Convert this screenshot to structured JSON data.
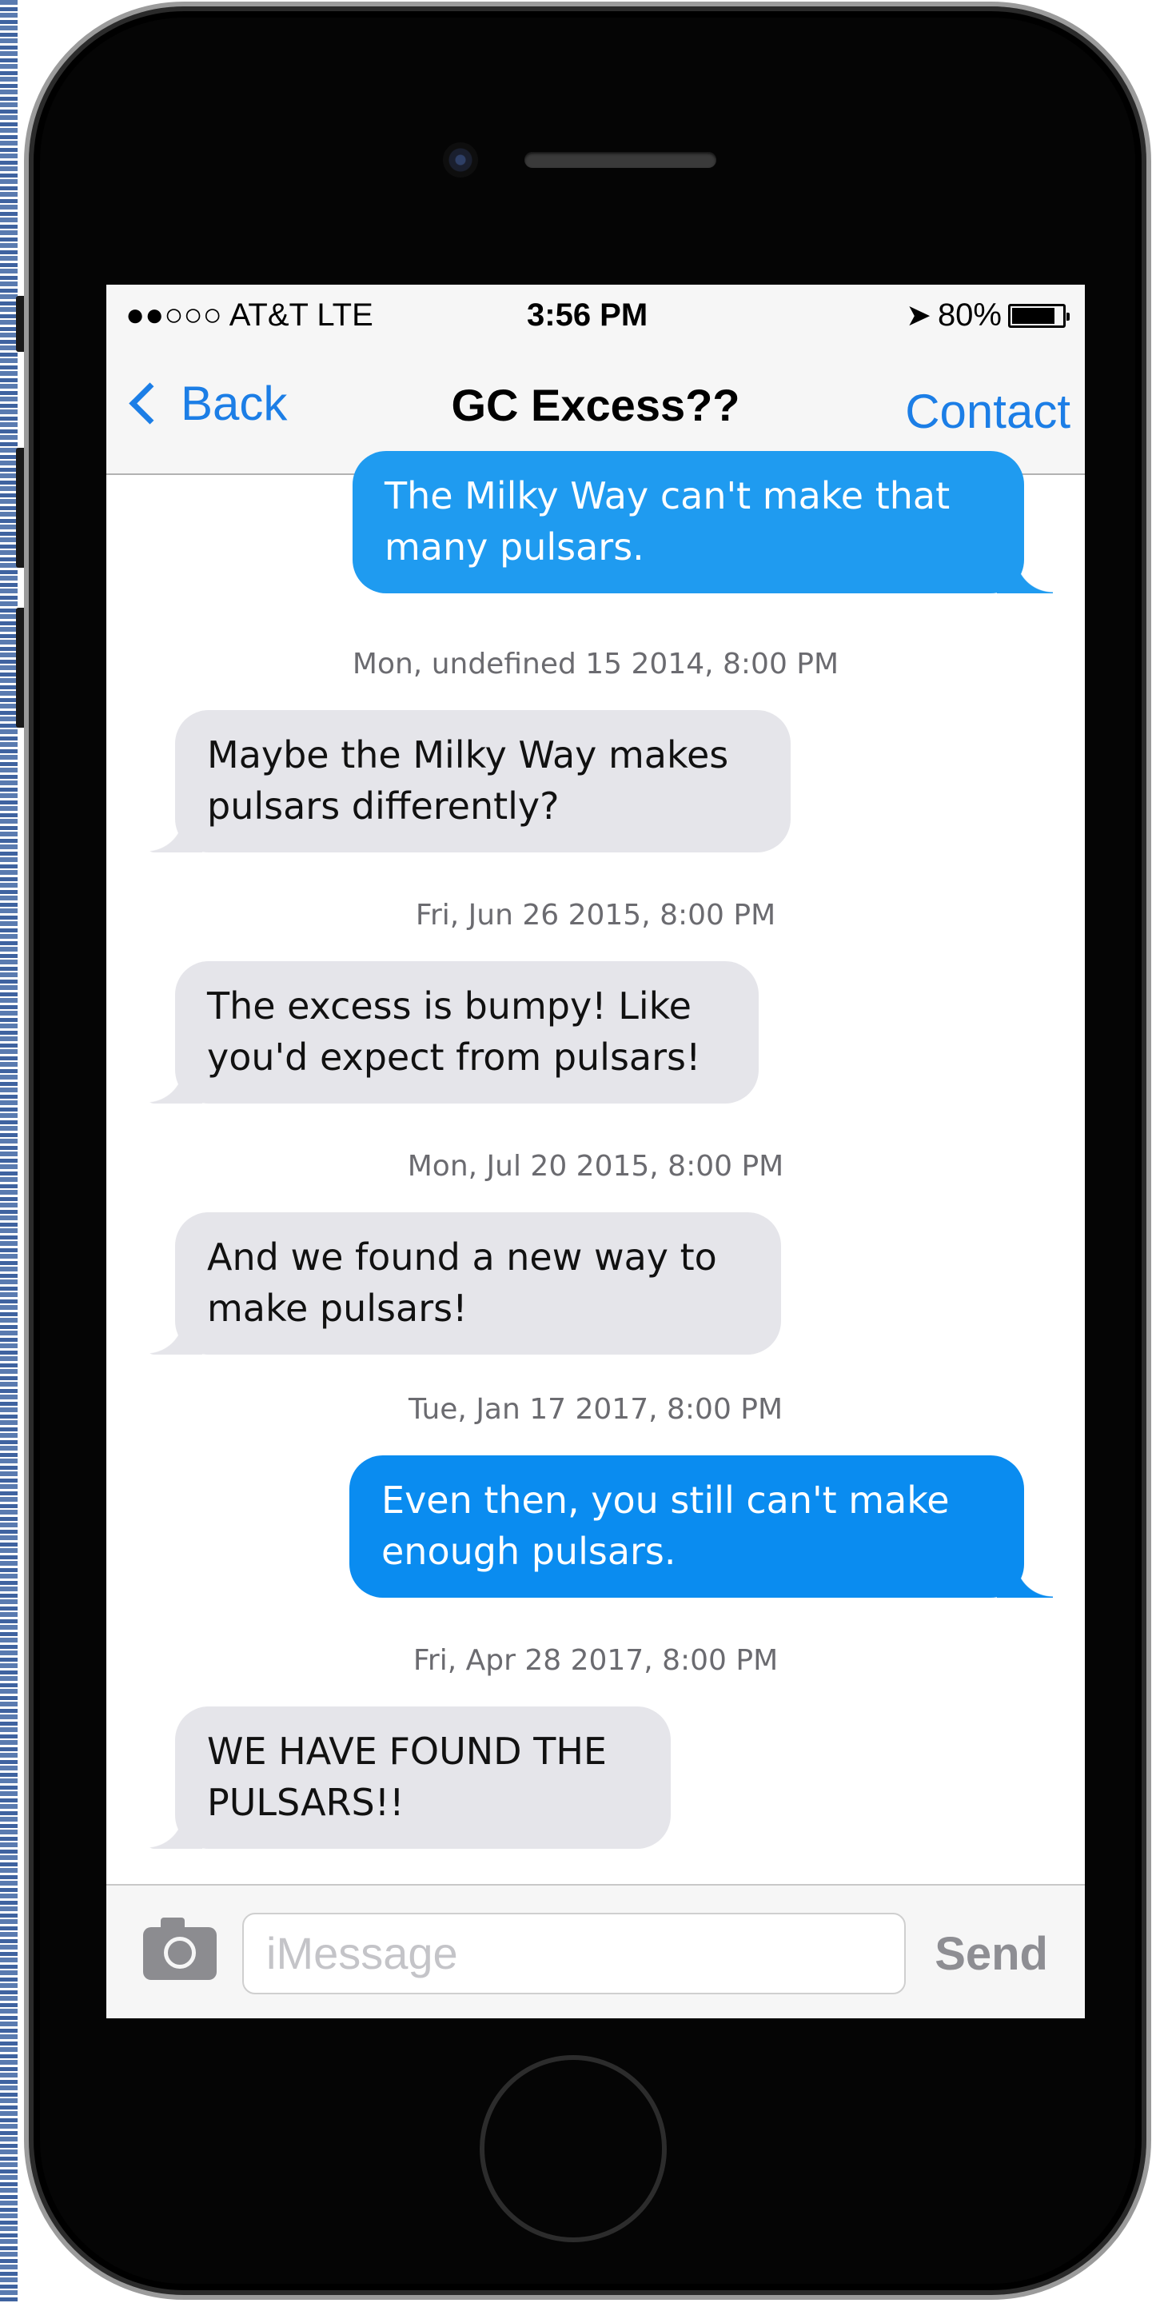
{
  "status_bar": {
    "carrier": "●●○○○ AT&T LTE",
    "time": "3:56 PM",
    "battery": "80%"
  },
  "nav": {
    "back_label": "Back",
    "title": "GC Excess??",
    "contact_label": "Contact"
  },
  "messages": [
    {
      "direction": "outgoing",
      "text": "The Milky Way can't make that many pulsars."
    },
    {
      "timestamp": "Mon, undefined 15 2014, 8:00 PM"
    },
    {
      "direction": "incoming",
      "text": "Maybe the Milky Way makes pulsars differently?"
    },
    {
      "timestamp": "Fri, Jun 26 2015, 8:00 PM"
    },
    {
      "direction": "incoming",
      "text": "The excess is bumpy! Like you'd expect from pulsars!"
    },
    {
      "timestamp": "Mon, Jul 20 2015, 8:00 PM"
    },
    {
      "direction": "incoming",
      "text": "And we found a new way to make pulsars!"
    },
    {
      "timestamp": "Tue, Jan 17 2017, 8:00 PM"
    },
    {
      "direction": "outgoing",
      "text": "Even then, you still can't make enough pulsars."
    },
    {
      "timestamp": "Fri, Apr 28 2017, 8:00 PM"
    },
    {
      "direction": "incoming",
      "text": "WE HAVE FOUND THE PULSARS!!"
    }
  ],
  "input_bar": {
    "placeholder": "iMessage",
    "send_label": "Send"
  },
  "colors": {
    "ios_blue": "#1c7ee6",
    "outgoing_bubble": "#1f9bf0",
    "incoming_bubble": "#e5e5ea"
  }
}
